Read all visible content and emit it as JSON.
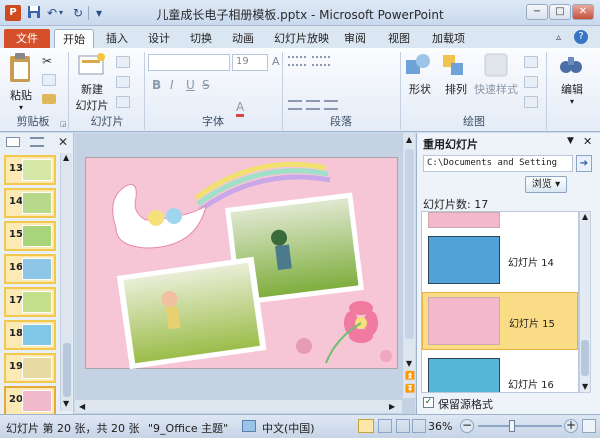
{
  "window": {
    "title": "儿童成长电子相册模板.pptx - Microsoft PowerPoint",
    "min_label": "−",
    "max_label": "□",
    "close_label": "✕"
  },
  "quick_access": {
    "undo": "↶",
    "redo": "↻",
    "customize": "▾"
  },
  "tabs": [
    {
      "label": "文件"
    },
    {
      "label": "开始"
    },
    {
      "label": "插入"
    },
    {
      "label": "设计"
    },
    {
      "label": "切换"
    },
    {
      "label": "动画"
    },
    {
      "label": "幻灯片放映"
    },
    {
      "label": "审阅"
    },
    {
      "label": "视图"
    },
    {
      "label": "加载项"
    }
  ],
  "ribbon": {
    "clipboard": {
      "label": "剪贴板",
      "paste": "粘贴"
    },
    "slides": {
      "label": "幻灯片",
      "new_slide": "新建",
      "new_slide2": "幻灯片"
    },
    "font": {
      "label": "字体",
      "size": "19"
    },
    "paragraph": {
      "label": "段落"
    },
    "drawing": {
      "label": "绘图",
      "shapes": "形状",
      "arrange": "排列",
      "quick_styles": "快速样式"
    },
    "editing": {
      "label": "编辑"
    }
  },
  "thumbnails": [
    {
      "num": "13",
      "color": "#d6e8a8"
    },
    {
      "num": "14",
      "color": "#b9d98a"
    },
    {
      "num": "15",
      "color": "#a8d47c"
    },
    {
      "num": "16",
      "color": "#8ec6e8"
    },
    {
      "num": "17",
      "color": "#c4e08c"
    },
    {
      "num": "18",
      "color": "#7fc7e6"
    },
    {
      "num": "19",
      "color": "#e6d9a2"
    },
    {
      "num": "20",
      "color": "#f2b8cc"
    }
  ],
  "reuse_pane": {
    "title": "重用幻灯片",
    "path": "C:\\Documents and Setting",
    "browse": "浏览",
    "count_label": "幻灯片数: 17",
    "items": [
      {
        "label": "幻灯片 14",
        "color": "#4fa3d8"
      },
      {
        "label": "幻灯片 15",
        "color": "#f4b8cd"
      },
      {
        "label": "幻灯片 16",
        "color": "#56b7d9"
      }
    ],
    "keep_format": "保留源格式"
  },
  "status": {
    "slide_info": "幻灯片 第 20 张，共 20 张",
    "theme": "\"9_Office 主题\"",
    "language": "中文(中国)",
    "zoom": "36%"
  }
}
